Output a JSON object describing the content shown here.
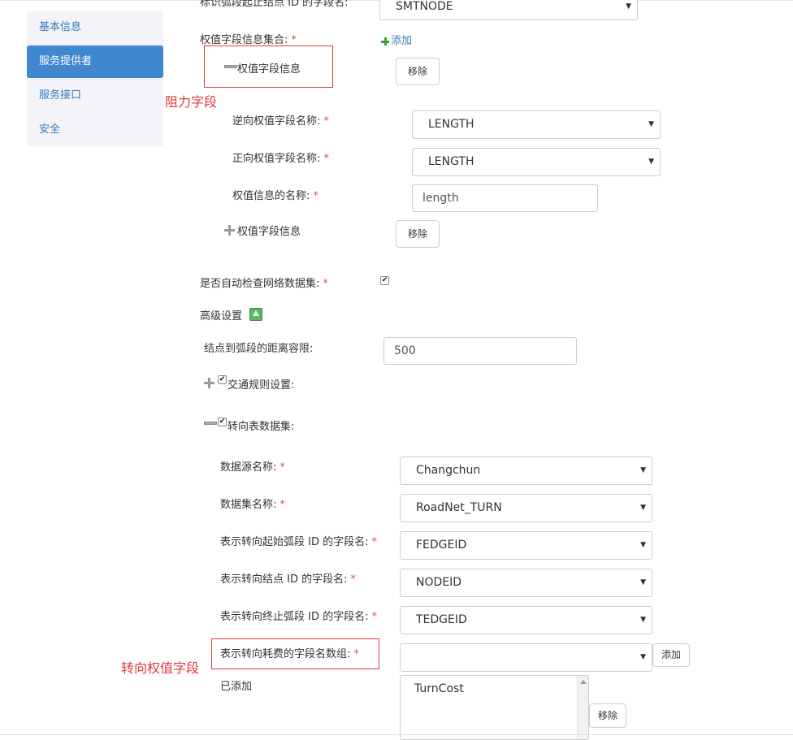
{
  "sidebar": {
    "items": [
      {
        "label": "基本信息",
        "active": false
      },
      {
        "label": "服务提供者",
        "active": true
      },
      {
        "label": "服务接口",
        "active": false
      },
      {
        "label": "安全",
        "active": false
      }
    ]
  },
  "top": {
    "cut_label": "标识弧段起止结点 ID 的字段名:",
    "cut_select_value": "SMTNODE"
  },
  "weights": {
    "label": "权值字段信息集合:",
    "required_mark": "*",
    "add_link": "添加",
    "group1_title": "权值字段信息",
    "remove_label": "移除",
    "reverse_label": "逆向权值字段名称:",
    "reverse_value": "LENGTH",
    "forward_label": "正向权值字段名称:",
    "forward_value": "LENGTH",
    "name_label": "权值信息的名称:",
    "name_value": "length",
    "group2_title": "权值字段信息",
    "remove2_label": "移除"
  },
  "annotations": {
    "resistance": "阻力字段",
    "turn_weight": "转向权值字段"
  },
  "auto_check": {
    "label": "是否自动检查网络数据集:",
    "checked": true
  },
  "advanced": {
    "label": "高级设置",
    "tolerance_label": "结点到弧段的距离容限:",
    "tolerance_value": "500",
    "traffic_rule_label": "交通规则设置:",
    "turn_table_label": "转向表数据集:"
  },
  "turn": {
    "datasource_label": "数据源名称:",
    "datasource_value": "Changchun",
    "dataset_label": "数据集名称:",
    "dataset_value": "RoadNet_TURN",
    "fedge_label": "表示转向起始弧段 ID 的字段名:",
    "fedge_value": "FEDGEID",
    "node_label": "表示转向结点 ID 的字段名:",
    "node_value": "NODEID",
    "tedge_label": "表示转向终止弧段 ID 的字段名:",
    "tedge_value": "TEDGEID",
    "cost_label": "表示转向耗费的字段名数组:",
    "cost_value": "",
    "add_label": "添加",
    "added_label": "已添加",
    "added_items": [
      "TurnCost"
    ],
    "remove_label": "移除"
  },
  "colors": {
    "accent": "#3f87cf",
    "required": "#d9534f",
    "annotation": "#e0393d"
  }
}
